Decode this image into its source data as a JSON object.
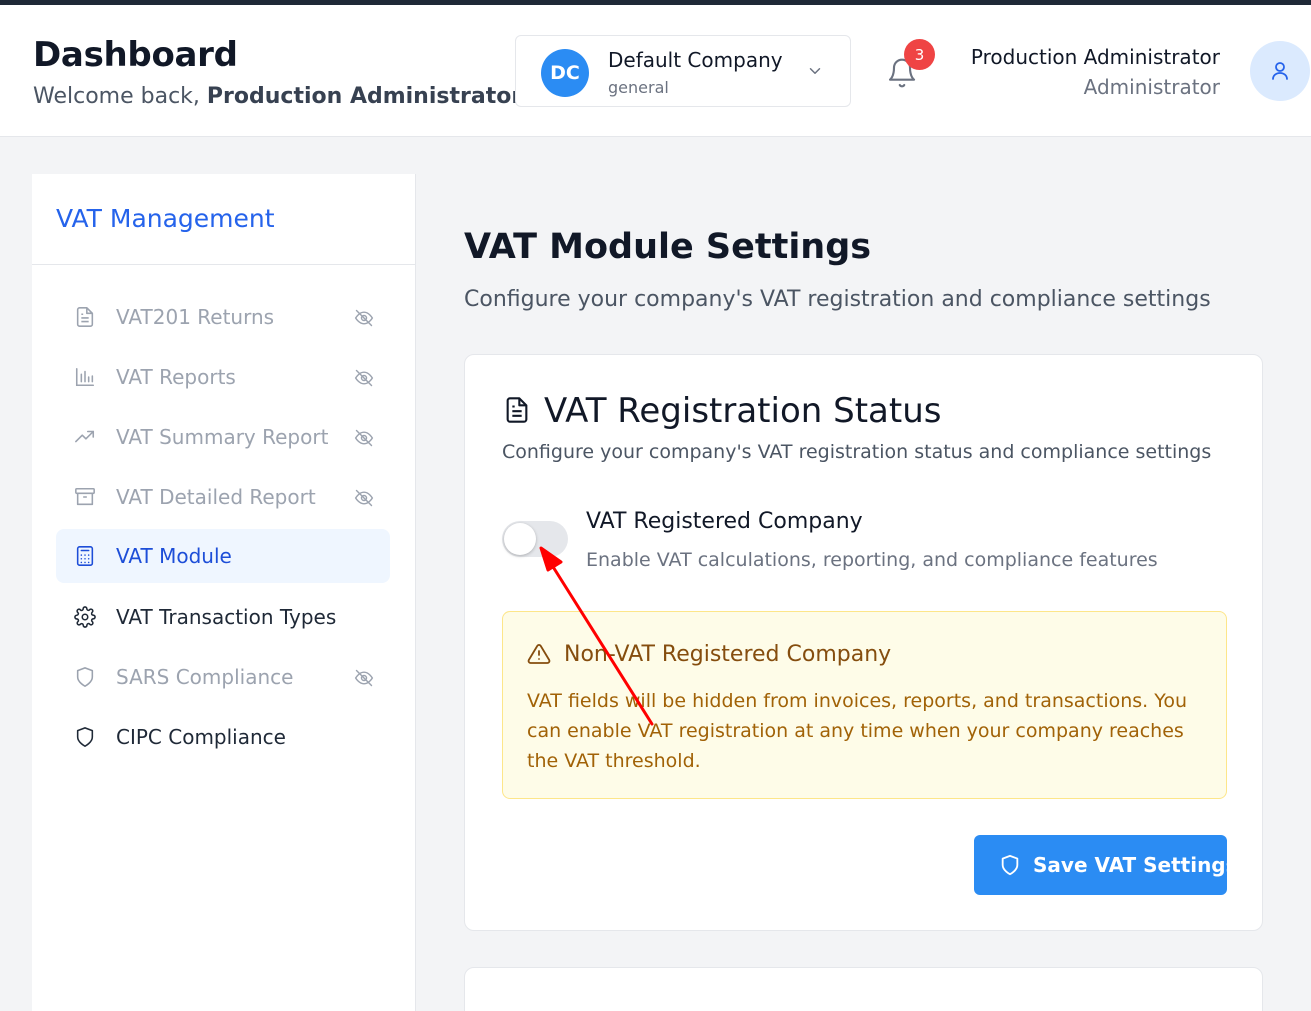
{
  "header": {
    "title": "Dashboard",
    "welcome_prefix": "Welcome back,",
    "welcome_user": "Production Administrator",
    "company": {
      "initials": "DC",
      "name": "Default Company",
      "sub": "general"
    },
    "notifications_count": "3",
    "user": {
      "name": "Production Administrator",
      "role": "Administrator"
    }
  },
  "sidebar": {
    "title": "VAT Management",
    "items": [
      {
        "label": "VAT201 Returns",
        "icon": "document-icon",
        "hidden": true
      },
      {
        "label": "VAT Reports",
        "icon": "bar-chart-icon",
        "hidden": true
      },
      {
        "label": "VAT Summary Report",
        "icon": "trending-up-icon",
        "hidden": true
      },
      {
        "label": "VAT Detailed Report",
        "icon": "archive-icon",
        "hidden": true
      },
      {
        "label": "VAT Module",
        "icon": "calculator-icon",
        "active": true
      },
      {
        "label": "VAT Transaction Types",
        "icon": "gear-icon"
      },
      {
        "label": "SARS Compliance",
        "icon": "shield-icon",
        "hidden": true
      },
      {
        "label": "CIPC Compliance",
        "icon": "shield-icon"
      }
    ]
  },
  "main": {
    "title": "VAT Module Settings",
    "subtitle": "Configure your company's VAT registration and compliance settings",
    "card": {
      "title": "VAT Registration Status",
      "subtitle": "Configure your company's VAT registration status and compliance settings",
      "toggle_label": "VAT Registered Company",
      "toggle_desc": "Enable VAT calculations, reporting, and compliance features",
      "toggle_on": false,
      "warning_title": "Non-VAT Registered Company",
      "warning_text": "VAT fields will be hidden from invoices, reports, and transactions. You can enable VAT registration at any time when your company reaches the VAT threshold.",
      "save_label": "Save VAT Settings"
    }
  },
  "colors": {
    "accent": "#2b8cf3",
    "active_text": "#1d4ed8",
    "warning_bg": "#fefce8",
    "warning_text": "#a16207",
    "badge": "#ef4444",
    "annotation_arrow": "#ff0000"
  }
}
